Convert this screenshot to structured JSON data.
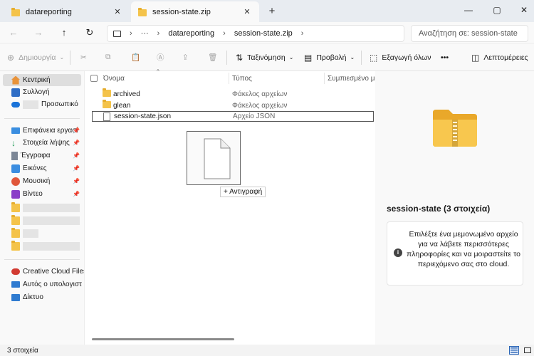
{
  "tabs": [
    {
      "label": "datareporting",
      "active": false
    },
    {
      "label": "session-state.zip",
      "active": true
    }
  ],
  "window": {
    "new_tab": "+",
    "minimize": "—",
    "maximize": "▢",
    "close": "✕"
  },
  "nav": {
    "back": "←",
    "forward": "→",
    "up": "↑",
    "refresh": "↻"
  },
  "address": {
    "overflow": "···",
    "segments": [
      "datareporting",
      "session-state.zip"
    ],
    "separator": "›"
  },
  "search": {
    "placeholder": "Αναζήτηση σε: session-state"
  },
  "commands": {
    "new": "Δημιουργία",
    "sort": "Ταξινόμηση",
    "view": "Προβολή",
    "extract_all": "Εξαγωγή όλων",
    "more": "•••",
    "details": "Λεπτομέρειες"
  },
  "sidebar": {
    "home": "Κεντρική",
    "gallery": "Συλλογή",
    "onedrive": "Προσωπικό",
    "pinned": [
      {
        "label": "Επιφάνεια εργασί"
      },
      {
        "label": "Στοιχεία λήψης"
      },
      {
        "label": "Έγγραφα"
      },
      {
        "label": "Εικόνες"
      },
      {
        "label": "Μουσική"
      },
      {
        "label": "Βίντεο"
      }
    ],
    "bottom": [
      {
        "label": "Creative Cloud Files F"
      },
      {
        "label": "Αυτός ο υπολογιστ"
      },
      {
        "label": "Δίκτυο"
      }
    ]
  },
  "columns": {
    "name": "Όνομα",
    "type": "Τύπος",
    "size": "Συμπιεσμένο μέγ"
  },
  "files": [
    {
      "name": "archived",
      "type": "Φάκελος αρχείων",
      "kind": "folder"
    },
    {
      "name": "glean",
      "type": "Φάκελος αρχείων",
      "kind": "folder"
    },
    {
      "name": "session-state.json",
      "type": "Αρχείο JSON",
      "kind": "file"
    }
  ],
  "drag": {
    "label": "+ Αντιγραφή"
  },
  "details": {
    "title": "session-state (3 στοιχεία)",
    "message": "Επιλέξτε ένα μεμονωμένο αρχείο για να λάβετε περισσότερες πληροφορίες και να μοιραστείτε το περιεχόμενο σας στο cloud.",
    "info_glyph": "i"
  },
  "status": {
    "count": "3 στοιχεία"
  },
  "colors": {
    "folder": "#f4c34a",
    "accent": "#2a64b6"
  }
}
